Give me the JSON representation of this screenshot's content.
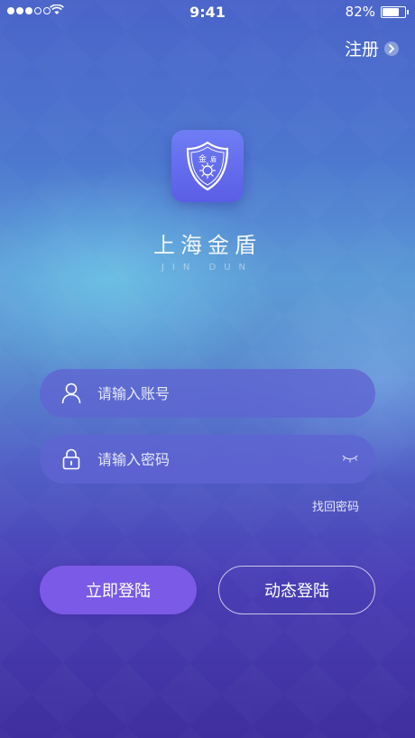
{
  "status_bar": {
    "time": "9:41",
    "battery_percent": "82%",
    "battery_level": 0.82
  },
  "header": {
    "register_label": "注册"
  },
  "brand": {
    "name": "上海金盾",
    "subtitle": "JIN DUN",
    "logo_text_left": "金",
    "logo_text_right": "盾"
  },
  "form": {
    "account_placeholder": "请输入账号",
    "password_placeholder": "请输入密码",
    "forgot_label": "找回密码"
  },
  "buttons": {
    "login_label": "立即登陆",
    "dynamic_login_label": "动态登陆"
  },
  "colors": {
    "primary_button": "#7a5ae6",
    "field_bg": "#5f64d2",
    "logo_bg": "#6f7df4"
  },
  "icons": [
    "signal-icon",
    "wifi-icon",
    "battery-icon",
    "chevron-right-icon",
    "shield-logo-icon",
    "user-icon",
    "lock-icon",
    "eye-closed-icon"
  ]
}
